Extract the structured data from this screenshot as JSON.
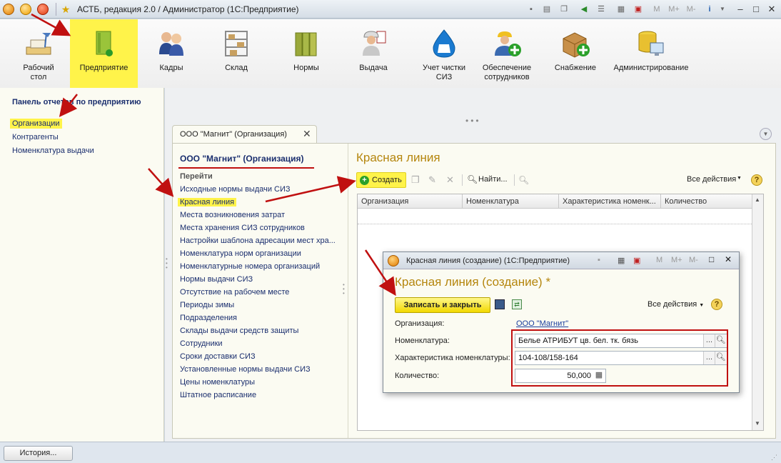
{
  "window": {
    "title": "АСТБ, редакция 2.0 / Администратор  (1С:Предприятие)",
    "toolbar_marks": {
      "m": "M",
      "mplus": "M+",
      "mminus": "M-"
    }
  },
  "sections": [
    {
      "id": "desktop",
      "label": "Рабочий стол",
      "icon": "desk-lamp-icon"
    },
    {
      "id": "enterprise",
      "label": "Предприятие",
      "icon": "book-icon",
      "active": true
    },
    {
      "id": "staff",
      "label": "Кадры",
      "icon": "people-icon"
    },
    {
      "id": "warehouse",
      "label": "Склад",
      "icon": "shelves-icon"
    },
    {
      "id": "norms",
      "label": "Нормы",
      "icon": "binders-icon"
    },
    {
      "id": "issue",
      "label": "Выдача",
      "icon": "worker-icon"
    },
    {
      "id": "cleaning",
      "label": "Учет чистки СИЗ",
      "icon": "drop-icon"
    },
    {
      "id": "provision",
      "label": "Обеспечение сотрудников",
      "icon": "person-add-icon"
    },
    {
      "id": "supply",
      "label": "Снабжение",
      "icon": "box-add-icon"
    },
    {
      "id": "admin",
      "label": "Администрирование",
      "icon": "database-icon"
    }
  ],
  "left_panel": {
    "title": "Панель отчетов по предприятию",
    "items": [
      "Организации",
      "Контрагенты",
      "Номенклатура выдачи"
    ]
  },
  "tab": {
    "title": "ООО \"Магнит\" (Организация)",
    "close": "✕"
  },
  "form": {
    "title": "ООО \"Магнит\" (Организация)",
    "goto_label": "Перейти",
    "nav_items": [
      "Исходные нормы выдачи СИЗ",
      "Красная линия",
      "Места возникновения затрат",
      "Места хранения СИЗ сотрудников",
      "Настройки шаблона адресации мест хра...",
      "Номенклатура норм организации",
      "Номенклатурные номера организаций",
      "Нормы выдачи СИЗ",
      "Отсутствие на рабочем месте",
      "Периоды зимы",
      "Подразделения",
      "Склады выдачи средств защиты",
      "Сотрудники",
      "Сроки доставки СИЗ",
      "Установленные нормы выдачи СИЗ",
      "Цены номенклатуры",
      "Штатное расписание"
    ],
    "list_title": "Красная линия",
    "toolbar": {
      "create": "Создать",
      "find": "Найти...",
      "all_actions": "Все действия",
      "help": "?"
    },
    "columns": [
      "Организация",
      "Номенклатура",
      "Характеристика номенк...",
      "Количество"
    ]
  },
  "modal": {
    "window_title": "Красная линия (создание)  (1С:Предприятие)",
    "title": "Красная линия (создание) *",
    "save_close": "Записать и закрыть",
    "all_actions": "Все действия",
    "help": "?",
    "toolbar_marks": {
      "m": "M",
      "mplus": "M+",
      "mminus": "M-"
    },
    "fields": {
      "org_label": "Организация:",
      "org_value": "ООО \"Магнит\"",
      "nom_label": "Номенклатура:",
      "nom_value": "Белье АТРИБУТ цв. бел. тк. бязь",
      "char_label": "Характеристика номенклатуры:",
      "char_value": "104-108/158-164",
      "qty_label": "Количество:",
      "qty_value": "50,000"
    }
  },
  "statusbar": {
    "history": "История..."
  },
  "colors": {
    "accent_yellow": "#fff34a",
    "link_blue": "#1a2e6e",
    "title_gold": "#b5860e",
    "annotation_red": "#c01010"
  }
}
